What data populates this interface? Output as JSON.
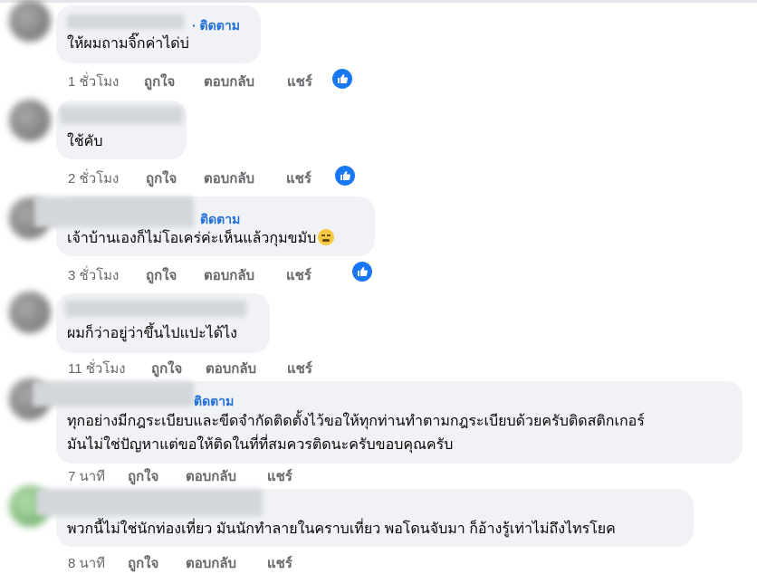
{
  "comments": [
    {
      "follow": "· ติดตาม",
      "text_lines": [
        "ให้ผมถามจิ๊กค่าได่บ่"
      ],
      "time": "1 ชั่วโมง",
      "like": "ถูกใจ",
      "reply": "ตอบกลับ",
      "share": "แชร์",
      "has_like_badge": true
    },
    {
      "follow": "",
      "text_lines": [
        "ใช้คับ"
      ],
      "time": "2 ชั่วโมง",
      "like": "ถูกใจ",
      "reply": "ตอบกลับ",
      "share": "แชร์",
      "has_like_badge": true
    },
    {
      "follow": "ติดตาม",
      "text_lines": [
        "เจ้าบ้านเองก็ไม่โอเคร่ค่ะเห็นแล้วกุมขมับ"
      ],
      "time": "3 ชั่วโมง",
      "like": "ถูกใจ",
      "reply": "ตอบกลับ",
      "share": "แชร์",
      "has_like_badge": true,
      "emoji": "weary-face-emoji"
    },
    {
      "follow": "",
      "text_lines": [
        "ผมก็ว่าอยู่ว่าขึ้นไปแปะได้ไง"
      ],
      "time": "11 ชั่วโมง",
      "like": "ถูกใจ",
      "reply": "ตอบกลับ",
      "share": "แชร์",
      "has_like_badge": false
    },
    {
      "follow": "ติดตาม",
      "text_lines": [
        "ทุกอย่างมีกฎระเบียบและขีดจำกัดติดตั้งไว้ขอให้ทุกท่านทำตามกฎระเบียบด้วยครับติดสติกเกอร์",
        "มันไม่ใช่ปัญหาแต่ขอให้ติดในที่ที่สมควรติดนะครับขอบคุณครับ"
      ],
      "time": "7 นาที",
      "like": "ถูกใจ",
      "reply": "ตอบกลับ",
      "share": "แชร์",
      "has_like_badge": false
    },
    {
      "follow": "",
      "text_lines": [
        "พวกนี้ไม่ใช่นักท่องเที่ยว มันนักทำลายในคราบเที่ยว พอโดนจับมา ก็อ้างรู้เท่าไม่ถึงไทรโยค"
      ],
      "time": "8 นาที",
      "like": "ถูกใจ",
      "reply": "ตอบกลับ",
      "share": "แชร์",
      "has_like_badge": false
    }
  ],
  "colors": {
    "bubble": "#f0f2f5",
    "link": "#216fdb",
    "meta": "#65676b",
    "like_badge": "#1877f2"
  }
}
